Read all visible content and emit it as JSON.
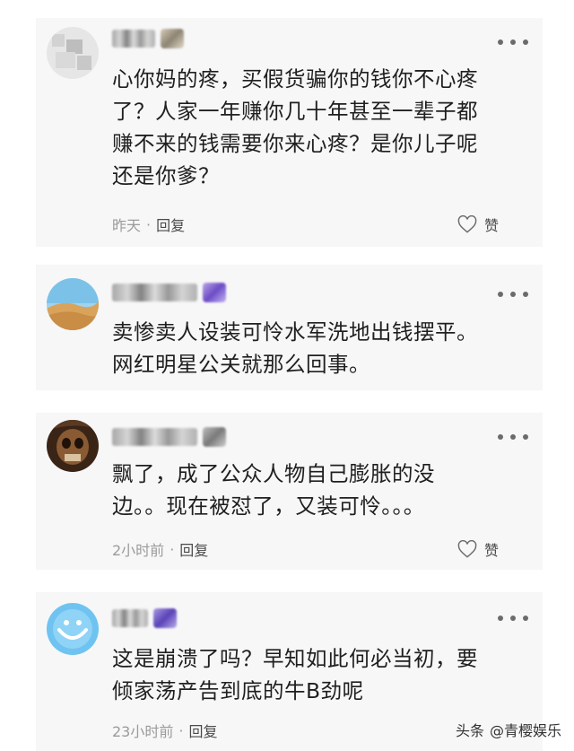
{
  "comments": [
    {
      "text": "心你妈的疼，买假货骗你的钱你不心疼\n了？人家一年赚你几十年甚至一辈子都\n赚不来的钱需要你来心疼？是你儿子呢\n还是你爹？",
      "time": "昨天",
      "reply": "回复",
      "like": "赞"
    },
    {
      "text": "卖惨卖人设装可怜水军洗地出钱摆平。\n网红明星公关就那么回事。"
    },
    {
      "text": "飘了，成了公众人物自己膨胀的没\n边。。现在被怼了，又装可怜。。。",
      "time": "2小时前",
      "reply": "回复",
      "like": "赞"
    },
    {
      "text": "这是崩溃了吗？早知如此何必当初，要\n倾家荡产告到底的牛B劲呢",
      "time": "23小时前",
      "reply": "回复"
    }
  ],
  "separator": "·",
  "watermark": {
    "source": "头条",
    "account": "@青樱娱乐"
  },
  "colors": {
    "card_bg": "#f7f7f8",
    "text": "#1f1f1f",
    "meta": "#9b9b9b"
  }
}
